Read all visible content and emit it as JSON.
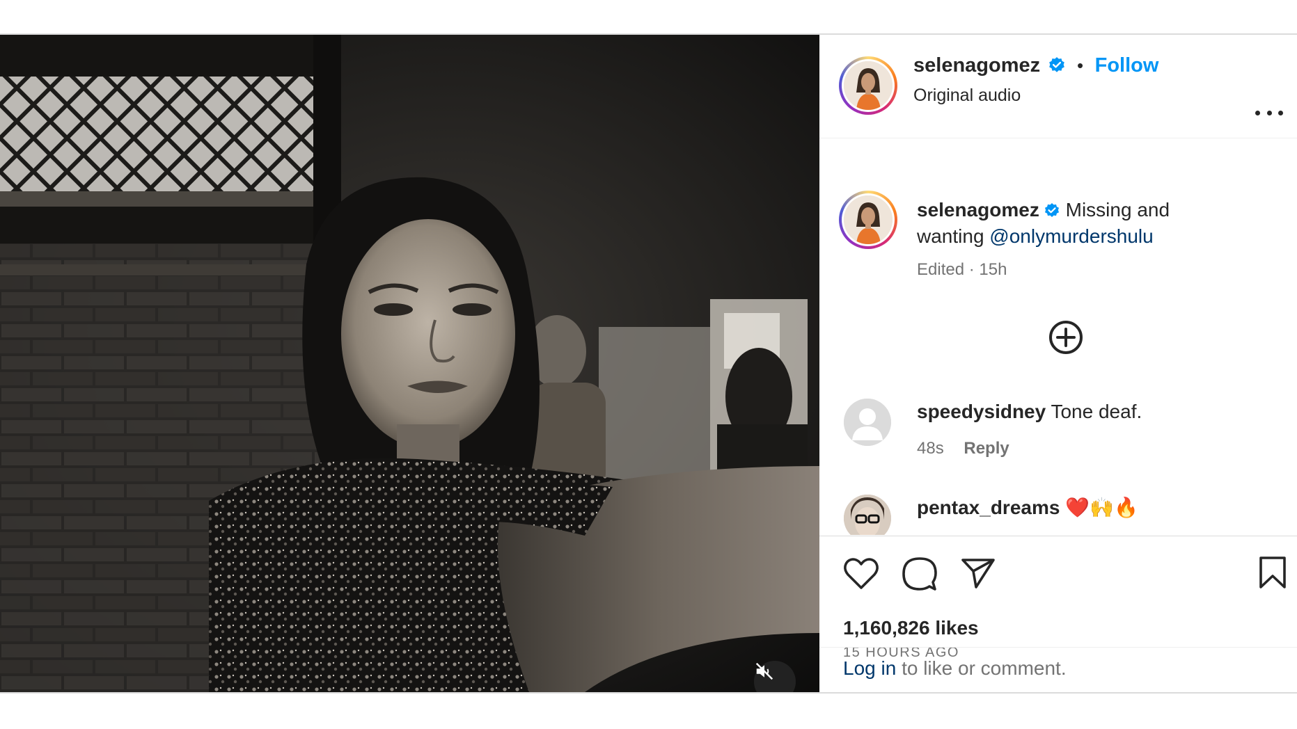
{
  "author": {
    "username": "selenagomez",
    "verified": true,
    "follow_label": "Follow",
    "separator": "•",
    "audio_label": "Original audio"
  },
  "caption": {
    "username": "selenagomez",
    "text_line1": "Missing and",
    "text_line2_prefix": "wanting",
    "mention": "@onlymurdershulu",
    "meta_edited": "Edited",
    "meta_dot": "·",
    "meta_time": "15h"
  },
  "comments": [
    {
      "username": "speedysidney",
      "text": "Tone deaf.",
      "time": "48s",
      "reply_label": "Reply"
    },
    {
      "username": "pentax_dreams",
      "text": "❤️🙌🔥"
    }
  ],
  "actions": {
    "likes": "1,160,826 likes",
    "time_ago": "15 HOURS AGO"
  },
  "login": {
    "link": "Log in",
    "rest": "to like or comment."
  },
  "colors": {
    "accent": "#0095f6",
    "link": "#00376b",
    "muted": "#737373",
    "text": "#262626"
  },
  "icons": [
    "verified-badge-icon",
    "more-options-icon",
    "add-comment-icon",
    "like-icon",
    "comment-icon",
    "share-icon",
    "save-icon",
    "mute-icon",
    "default-avatar-icon"
  ]
}
